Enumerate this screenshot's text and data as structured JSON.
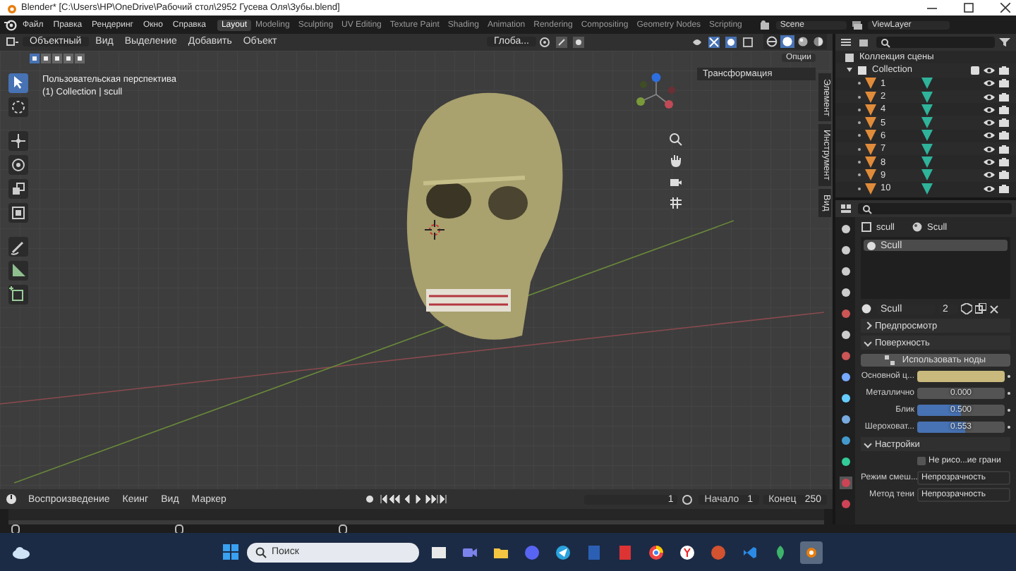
{
  "window": {
    "title": "Blender* [C:\\Users\\HP\\OneDrive\\Рабочий стол\\2952 Гусева Оля\\Зубы.blend]"
  },
  "menu": [
    "Файл",
    "Правка",
    "Рендеринг",
    "Окно",
    "Справка"
  ],
  "workspaces": [
    {
      "label": "Layout",
      "selected": true
    },
    {
      "label": "Modeling",
      "selected": false
    },
    {
      "label": "Sculpting",
      "selected": false
    },
    {
      "label": "UV Editing",
      "selected": false
    },
    {
      "label": "Texture Paint",
      "selected": false
    },
    {
      "label": "Shading",
      "selected": false
    },
    {
      "label": "Animation",
      "selected": false
    },
    {
      "label": "Rendering",
      "selected": false
    },
    {
      "label": "Compositing",
      "selected": false
    },
    {
      "label": "Geometry Nodes",
      "selected": false
    },
    {
      "label": "Scripting",
      "selected": false
    }
  ],
  "scene": "Scene",
  "view_layer": "ViewLayer",
  "viewport": {
    "mode": "Объектный",
    "menus": [
      "Вид",
      "Выделение",
      "Добавить",
      "Объект"
    ],
    "orientation": "Глоба...",
    "options": "Опции",
    "view_name": "Пользовательская перспектива",
    "collection_info": "(1) Collection | scull",
    "sidebar_panel": "Трансформация",
    "sidebar_tabs": [
      {
        "label": "Элемент",
        "selected": false
      },
      {
        "label": "Инструмент",
        "selected": false
      },
      {
        "label": "Вид",
        "selected": false
      }
    ],
    "tools": [
      {
        "kind": "select",
        "selected": true
      },
      {
        "kind": "cursor",
        "selected": false
      },
      {
        "kind": "move",
        "selected": false
      },
      {
        "kind": "rotate",
        "selected": false
      },
      {
        "kind": "scale",
        "selected": false
      },
      {
        "kind": "transform",
        "selected": false
      },
      {
        "kind": "annotate",
        "selected": false
      },
      {
        "kind": "measure",
        "selected": false
      },
      {
        "kind": "add-cube",
        "selected": false
      }
    ],
    "shading": [
      {
        "kind": "wireframe",
        "selected": false
      },
      {
        "kind": "solid",
        "selected": true
      },
      {
        "kind": "material",
        "selected": false
      },
      {
        "kind": "rendered",
        "selected": false
      }
    ]
  },
  "outliner": {
    "root": "Коллекция сцены",
    "collections": [
      {
        "label": "Collection",
        "checked": true,
        "expanded": true,
        "children": [
          {
            "label": "1"
          },
          {
            "label": "2"
          },
          {
            "label": "4"
          },
          {
            "label": "5"
          },
          {
            "label": "6"
          },
          {
            "label": "7"
          },
          {
            "label": "8"
          },
          {
            "label": "9"
          },
          {
            "label": "10"
          }
        ]
      }
    ]
  },
  "properties": {
    "breadcrumb": [
      "scull",
      "Scull"
    ],
    "slots": [
      {
        "label": "Scull",
        "selected": true
      }
    ],
    "material": "Scull",
    "users": "2",
    "panels": [
      {
        "title": "Предпросмотр",
        "expanded": false
      },
      {
        "title": "Поверхность",
        "expanded": true,
        "rows": [
          {
            "kind": "button",
            "label": "Использовать ноды"
          },
          {
            "kind": "color",
            "label": "Основной ц...",
            "color": "#c9b97c"
          },
          {
            "kind": "slider",
            "label": "Металлично",
            "value": "0.000",
            "level": 0
          },
          {
            "kind": "slider",
            "label": "Блик",
            "value": "0.500",
            "level": 0.5
          },
          {
            "kind": "slider",
            "label": "Шероховат...",
            "value": "0.553",
            "level": 0.553
          }
        ]
      },
      {
        "title": "Настройки",
        "expanded": true,
        "rows": [
          {
            "kind": "checkbox",
            "label": "Не рисо...ие грани",
            "checked": false
          },
          {
            "kind": "dropdown",
            "label": "Режим смеш...",
            "value": "Непрозрачность"
          },
          {
            "kind": "dropdown",
            "label": "Метод тени",
            "value": "Непрозрачность"
          }
        ]
      }
    ]
  },
  "timeline": {
    "menus": [
      "Воспроизведение",
      "Кеинг",
      "Вид",
      "Маркер"
    ],
    "current_frame": "1",
    "start_label": "Начало",
    "start": "1",
    "end_label": "Конец",
    "end": "250"
  },
  "taskbar": {
    "search_placeholder": "Поиск",
    "apps": [
      {
        "kind": "tile",
        "selected": false
      },
      {
        "kind": "video",
        "selected": false
      },
      {
        "kind": "folder",
        "selected": false
      },
      {
        "kind": "chat",
        "selected": false
      },
      {
        "kind": "send",
        "selected": false
      },
      {
        "kind": "doc",
        "selected": false
      },
      {
        "kind": "book",
        "selected": false
      },
      {
        "kind": "browser",
        "selected": false
      },
      {
        "kind": "ybrowser",
        "selected": false
      },
      {
        "kind": "slides",
        "selected": false
      },
      {
        "kind": "code",
        "selected": false
      },
      {
        "kind": "leaf",
        "selected": false
      },
      {
        "kind": "blender",
        "selected": true
      }
    ]
  }
}
